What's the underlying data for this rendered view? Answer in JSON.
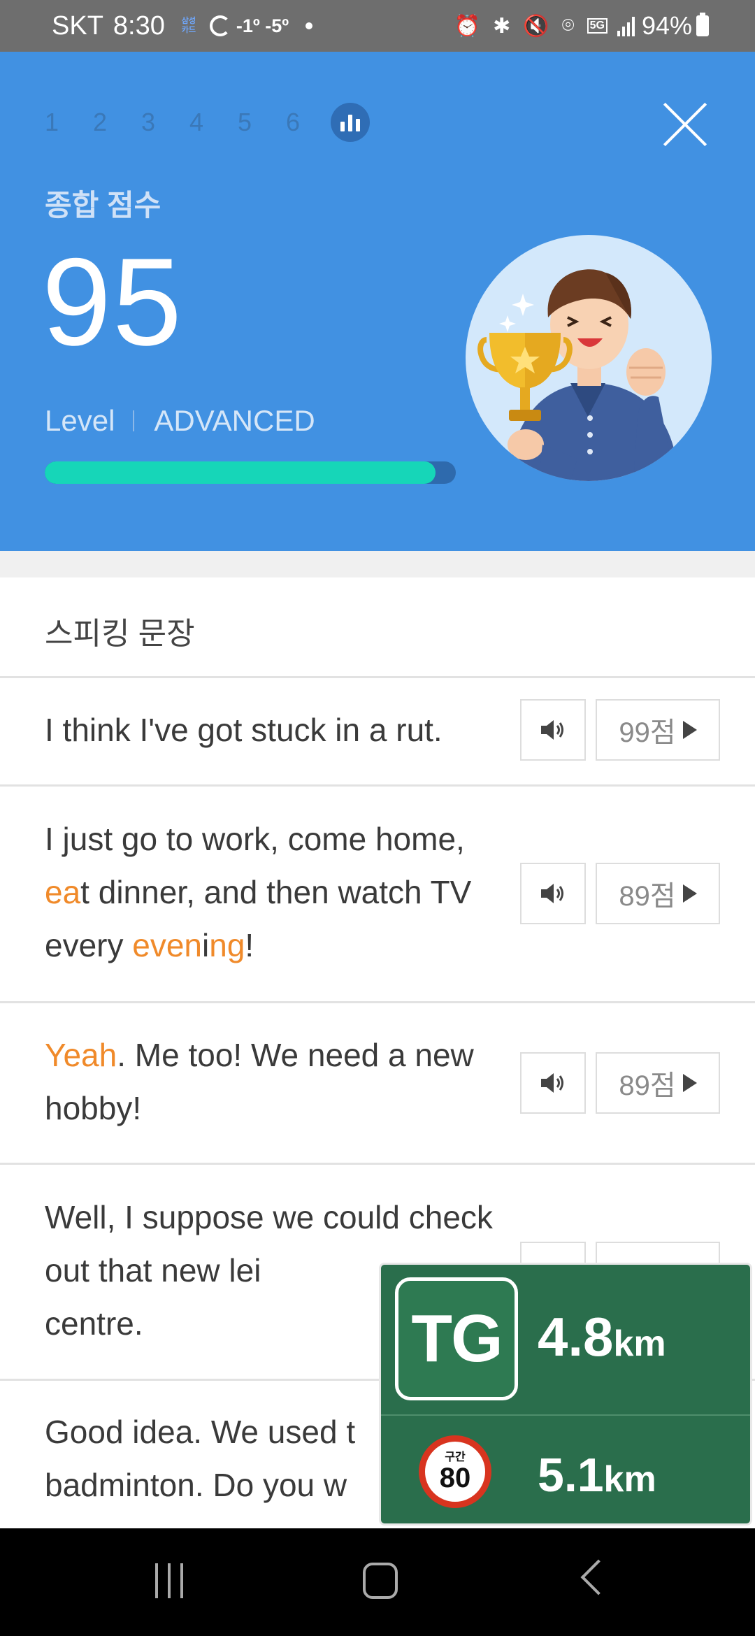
{
  "status_bar": {
    "carrier": "SKT",
    "time": "8:30",
    "card_app": [
      "삼성",
      "카드"
    ],
    "temperature": "-1º -5º",
    "network": "5G",
    "battery": "94%"
  },
  "hero": {
    "steps": [
      "1",
      "2",
      "3",
      "4",
      "5",
      "6"
    ],
    "active_step": "result-chart",
    "score_label": "종합 점수",
    "score": "95",
    "level_label": "Level",
    "level_value": "ADVANCED",
    "progress": 0.95,
    "colors": {
      "background": "#4191e2",
      "progress_fill": "#16d6b8",
      "progress_track": "#2e6aad"
    }
  },
  "list": {
    "title": "스피킹 문장",
    "highlight_color": "#f08a2a",
    "rows": [
      {
        "segments": [
          {
            "t": "I think I've got stuck in a rut.",
            "hl": false
          }
        ],
        "score": "99점"
      },
      {
        "segments": [
          {
            "t": "I just go to work, come home, ",
            "hl": false
          },
          {
            "t": "ea",
            "hl": true
          },
          {
            "t": "t dinner, and then watch TV every ",
            "hl": false
          },
          {
            "t": "even",
            "hl": true
          },
          {
            "t": "i",
            "hl": false
          },
          {
            "t": "ng",
            "hl": true
          },
          {
            "t": "!",
            "hl": false
          }
        ],
        "score": "89점"
      },
      {
        "segments": [
          {
            "t": "Yeah",
            "hl": true
          },
          {
            "t": ". Me too! We need a new hobby!",
            "hl": false
          }
        ],
        "score": "89점"
      },
      {
        "segments": [
          {
            "t": "Well, I suppose we could check out that new lei",
            "hl": false
          }
        ],
        "score": ""
      },
      {
        "segments": [
          {
            "t": "centre.",
            "hl": false
          }
        ],
        "score": ""
      },
      {
        "segments": [
          {
            "t": "Good idea. We used t",
            "hl": false
          }
        ],
        "score": ""
      },
      {
        "segments": [
          {
            "t": "badminton. Do you w",
            "hl": false
          }
        ],
        "score": ""
      }
    ]
  },
  "nav_overlay": {
    "badge": "TG",
    "distance_value": "4.8",
    "distance_unit": "km",
    "speed_zone_label": "구간",
    "speed_limit": "80",
    "zone_distance_value": "5.1",
    "zone_distance_unit": "km"
  }
}
